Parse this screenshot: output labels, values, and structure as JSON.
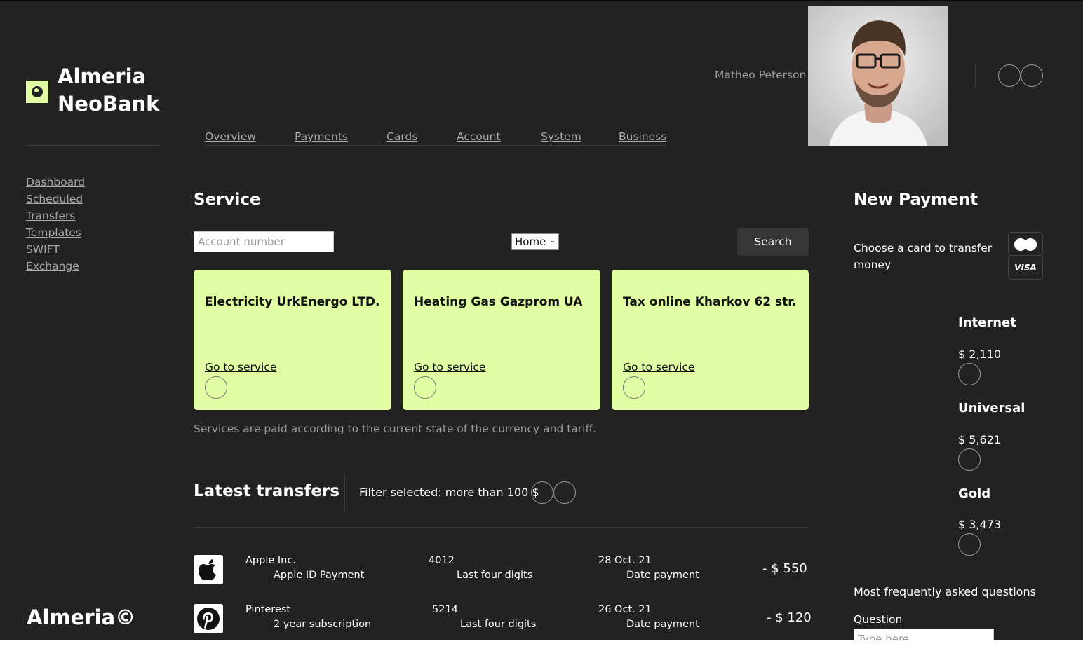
{
  "brand": {
    "line1": "Almeria",
    "line2": "NeoBank",
    "footer": "Almeria©",
    "accent": "#e2fea5",
    "background": "#222222"
  },
  "sidebar": {
    "items": [
      {
        "label": "Dashboard"
      },
      {
        "label": "Scheduled"
      },
      {
        "label": "Transfers"
      },
      {
        "label": "Templates"
      },
      {
        "label": "SWIFT"
      },
      {
        "label": "Exchange"
      }
    ]
  },
  "header": {
    "tabs": [
      {
        "label": "Overview"
      },
      {
        "label": "Payments"
      },
      {
        "label": "Cards"
      },
      {
        "label": "Account"
      },
      {
        "label": "System"
      },
      {
        "label": "Business"
      }
    ],
    "user_name": "Matheo Peterson",
    "avatar": "user-photo"
  },
  "service": {
    "title": "Service",
    "account_placeholder": "Account number",
    "select_value": "Home",
    "search_label": "Search",
    "cards": [
      {
        "title": "Electricity UrkEnergo LTD.",
        "link": "Go to service"
      },
      {
        "title": "Heating Gas Gazprom UA",
        "link": "Go to service"
      },
      {
        "title": "Tax online Kharkov 62 str.",
        "link": "Go to service"
      }
    ],
    "note": "Services are paid according to the current state of the currency and tariff."
  },
  "transfers": {
    "title": "Latest transfers",
    "filter": "Filter selected: more than 100 $",
    "rows": [
      {
        "icon": "apple-icon",
        "company": "Apple Inc.",
        "desc": "Apple ID Payment",
        "digits": "4012",
        "digits_label": "Last four digits",
        "date": "28 Oct. 21",
        "date_label": "Date payment",
        "amount": "- $ 550"
      },
      {
        "icon": "pinterest-icon",
        "company": "Pinterest",
        "desc": "2 year subscription",
        "digits": "5214",
        "digits_label": "Last four digits",
        "date": "26 Oct. 21",
        "date_label": "Date payment",
        "amount": "- $ 120"
      }
    ]
  },
  "new_payment": {
    "title": "New Payment",
    "choose_text": "Choose a card to transfer money",
    "card_brands": [
      "mastercard-icon",
      "VISA"
    ],
    "plans": [
      {
        "name": "Internet",
        "value": "$ 2,110"
      },
      {
        "name": "Universal",
        "value": "$ 5,621"
      },
      {
        "name": "Gold",
        "value": "$ 3,473"
      }
    ],
    "faq_title": "Most frequently asked questions",
    "question_label": "Question",
    "question_placeholder": "Type here"
  }
}
